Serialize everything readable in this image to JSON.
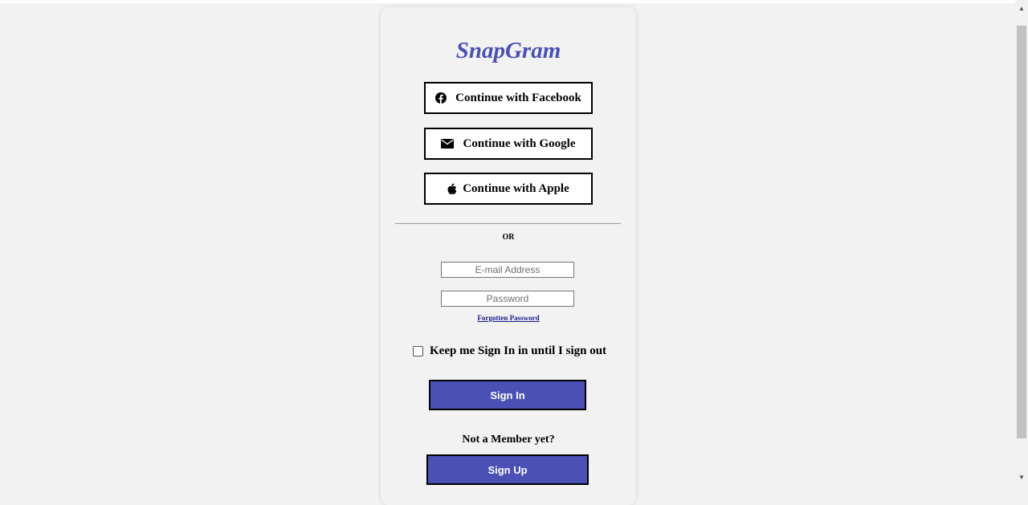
{
  "app": {
    "logo": "SnapGram"
  },
  "social": {
    "facebook_label": "Continue with Facebook",
    "google_label": "Continue with Google",
    "apple_label": "Continue with Apple"
  },
  "divider": {
    "or_label": "OR"
  },
  "form": {
    "email_placeholder": "E-mail Address",
    "email_value": "",
    "password_placeholder": "Password",
    "password_value": "",
    "forgot_label": "Forgotten Password",
    "keep_signed_in_label": "Keep me Sign In in until I sign out",
    "keep_signed_in_checked": false,
    "sign_in_label": "Sign In"
  },
  "signup": {
    "prompt": "Not a Member yet?",
    "button_label": "Sign Up"
  },
  "colors": {
    "accent": "#4a50b4",
    "background": "#f2f2f2"
  },
  "icons": {
    "facebook": "facebook-icon",
    "google": "envelope-icon",
    "apple": "apple-icon"
  }
}
